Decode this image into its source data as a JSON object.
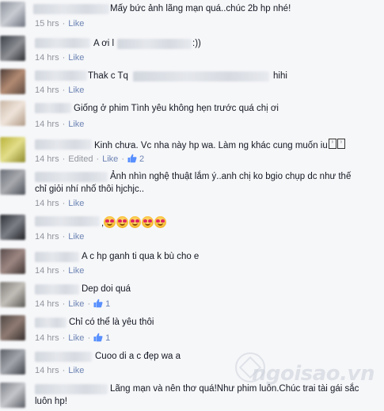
{
  "labels": {
    "like": "Like",
    "edited": "Edited",
    "separator": "·"
  },
  "comments": [
    {
      "text": "Mấy bức ảnh lãng mạn quá..chúc 2b hp nhé!",
      "time": "15 hrs",
      "edited": false,
      "likes": null
    },
    {
      "text_parts": [
        "A ơi l",
        ":))"
      ],
      "time": "14 hrs",
      "edited": false,
      "likes": null
    },
    {
      "text_parts": [
        "Thak c Tq",
        "hihi"
      ],
      "time": "14 hrs",
      "edited": false,
      "likes": null
    },
    {
      "text": "Giống ở phim Tình yêu không hẹn trước quá chị ơi",
      "time": "14 hrs",
      "edited": false,
      "likes": null
    },
    {
      "text": "Kinh chưa. Vc nha này hp wa. Làm ng khác cung muốn iu",
      "time": "14 hrs",
      "edited": true,
      "likes": "2"
    },
    {
      "lines": [
        "Ảnh nhìn nghệ thuật lắm ý..anh chị ko bgio chụp dc như thế",
        "chỉ giỏi nhí nhố thôi hjchjc.."
      ],
      "time": "14 hrs",
      "edited": false,
      "likes": null
    },
    {
      "emoji_count": 5,
      "time": "14 hrs",
      "edited": false,
      "likes": null
    },
    {
      "text": "A c hp ganh ti qua k bù cho e",
      "time": "14 hrs",
      "edited": false,
      "likes": null
    },
    {
      "text": "Dep doi quá",
      "time": "14 hrs",
      "edited": false,
      "likes": "1"
    },
    {
      "text": "Chỉ có thể là yêu thôi",
      "time": "14 hrs",
      "edited": false,
      "likes": "1"
    },
    {
      "text": "Cuoo di a c đẹp wa a",
      "time": "14 hrs",
      "edited": false,
      "likes": null
    },
    {
      "lines": [
        "Lãng mạn và nên thơ quá!Như phim luôn.Chúc trai tài gái sắc",
        "luôn hp!"
      ],
      "time": null,
      "edited": false,
      "likes": null
    }
  ],
  "watermark": {
    "text": "ngoisao.vn"
  },
  "colors": {
    "link": "#6d84b4",
    "meta": "#90949c",
    "text": "#141823",
    "background": "#f6f7f9"
  }
}
